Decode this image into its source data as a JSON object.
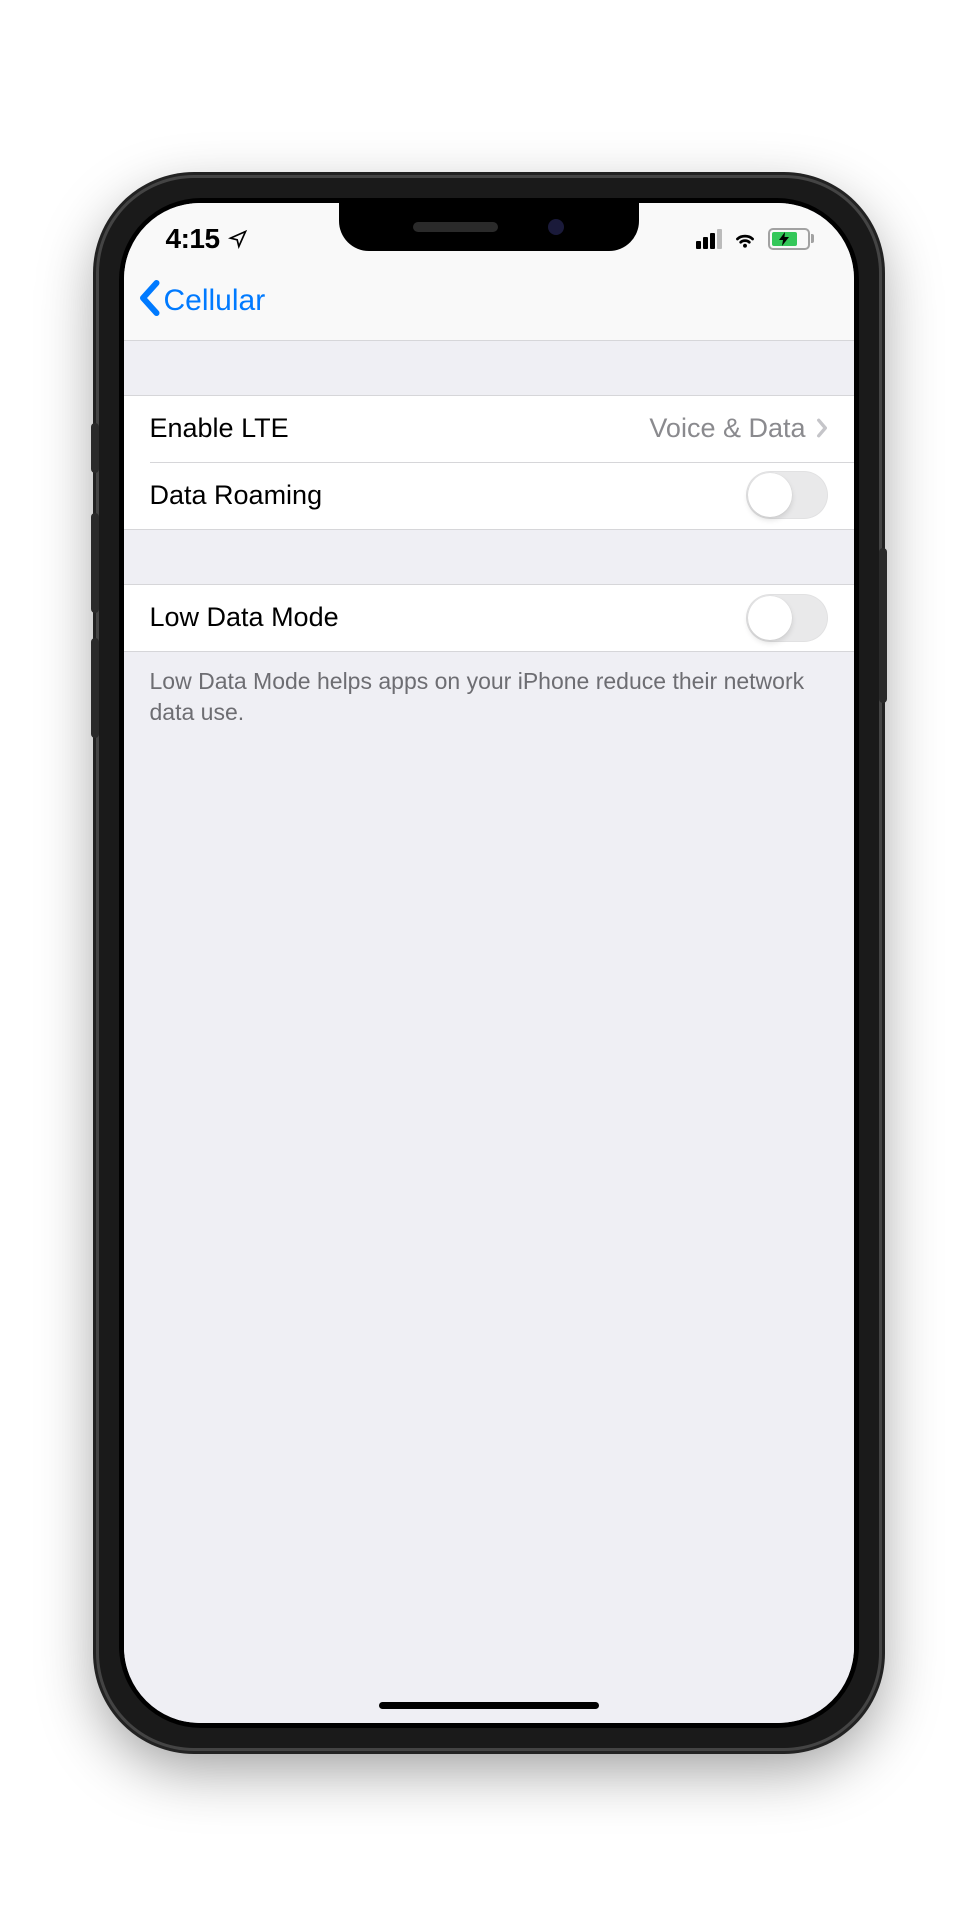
{
  "status": {
    "time": "4:15"
  },
  "nav": {
    "back_label": "Cellular"
  },
  "section1": {
    "enable_lte": {
      "label": "Enable LTE",
      "value": "Voice & Data"
    },
    "data_roaming": {
      "label": "Data Roaming",
      "on": false
    }
  },
  "section2": {
    "low_data_mode": {
      "label": "Low Data Mode",
      "on": false
    },
    "footer": "Low Data Mode helps apps on your iPhone reduce their network data use."
  }
}
